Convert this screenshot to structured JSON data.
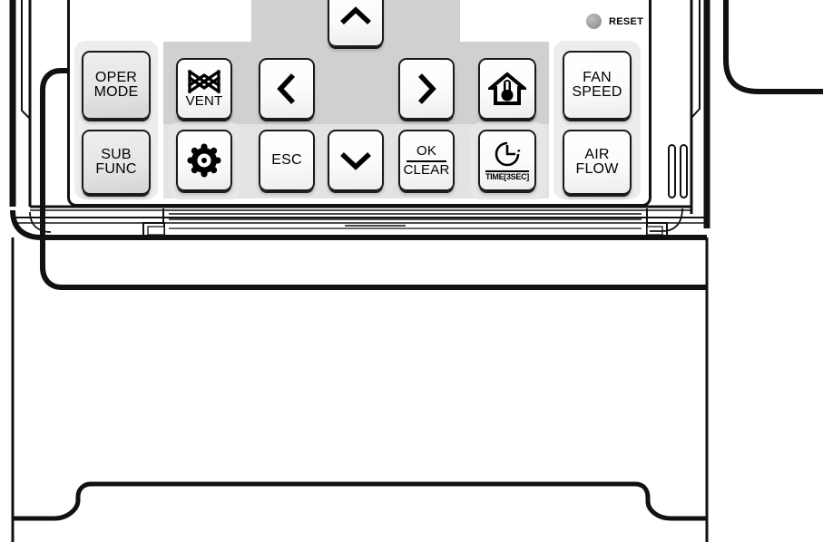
{
  "device": {
    "name": "wall-mounted-controller-keypad",
    "indicator": {
      "label": "RESET",
      "lamp_color": "#9e9e9e"
    }
  },
  "keypad": {
    "rows": [
      {
        "name": "top-row",
        "keys": [
          {
            "id": "oper-mode",
            "lines": [
              "OPER",
              "MODE"
            ],
            "style": "shaded",
            "icon": null
          },
          {
            "id": "vent",
            "lines": [
              "VENT"
            ],
            "style": "plain",
            "icon": "vent-icon"
          },
          {
            "id": "nav-left",
            "lines": [],
            "style": "plain",
            "icon": "chevron-left-icon"
          },
          {
            "id": "nav-up",
            "lines": [],
            "style": "plain",
            "icon": "chevron-up-icon"
          },
          {
            "id": "nav-right",
            "lines": [],
            "style": "plain",
            "icon": "chevron-right-icon"
          },
          {
            "id": "room-temp",
            "lines": [],
            "style": "plain",
            "icon": "house-thermometer-icon"
          },
          {
            "id": "fan-speed",
            "lines": [
              "FAN",
              "SPEED"
            ],
            "style": "plain",
            "icon": null
          }
        ]
      },
      {
        "name": "bottom-row",
        "keys": [
          {
            "id": "sub-func",
            "lines": [
              "SUB",
              "FUNC"
            ],
            "style": "shaded",
            "icon": null
          },
          {
            "id": "settings",
            "lines": [],
            "style": "plain",
            "icon": "gear-icon"
          },
          {
            "id": "esc",
            "lines": [
              "ESC"
            ],
            "style": "plain",
            "icon": null
          },
          {
            "id": "nav-down",
            "lines": [],
            "style": "plain",
            "icon": "chevron-down-icon"
          },
          {
            "id": "ok-clear",
            "lines": [
              "OK",
              "CLEAR"
            ],
            "style": "plain",
            "icon": null,
            "divider": true
          },
          {
            "id": "timer",
            "lines": [],
            "style": "plain",
            "icon": "clock-icon",
            "caption": "TIME[3SEC]"
          },
          {
            "id": "air-flow",
            "lines": [
              "AIR",
              "FLOW"
            ],
            "style": "plain",
            "icon": null
          }
        ]
      }
    ],
    "labels": {
      "oper_mode_l1": "OPER",
      "oper_mode_l2": "MODE",
      "sub_func_l1": "SUB",
      "sub_func_l2": "FUNC",
      "vent": "VENT",
      "esc": "ESC",
      "ok": "OK",
      "clear": "CLEAR",
      "time_caption": "TIME[3SEC]",
      "fan_speed_l1": "FAN",
      "fan_speed_l2": "SPEED",
      "air_flow_l1": "AIR",
      "air_flow_l2": "FLOW",
      "reset": "RESET"
    }
  },
  "colors": {
    "outline": "#111111",
    "panel_gray": "#d0d0d0",
    "tray_gray": "#ededed",
    "key_face": "#fbfbfb",
    "key_shaded": "#e6e6e6",
    "lamp": "#9e9e9e"
  }
}
